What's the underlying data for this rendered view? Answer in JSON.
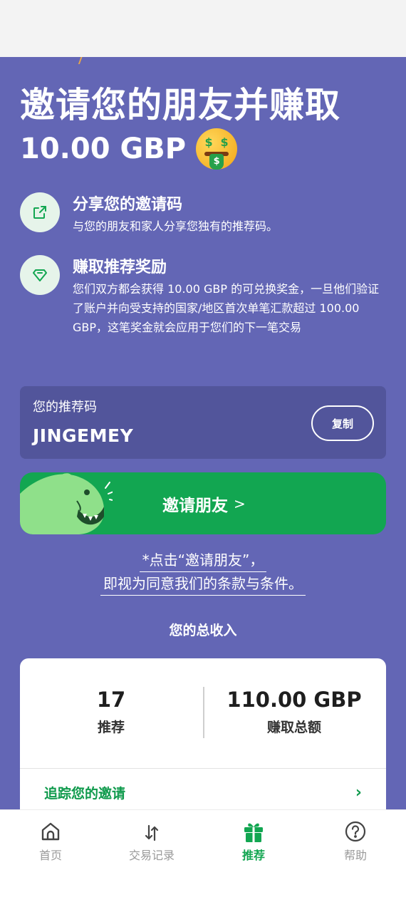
{
  "header": {
    "title": "邀请您的朋友并赚取",
    "amount": "10.00 GBP",
    "emoji_icon": "money-mouth-face-icon"
  },
  "features": [
    {
      "icon": "share-icon",
      "heading": "分享您的邀请码",
      "description": "与您的朋友和家人分享您独有的推荐码。"
    },
    {
      "icon": "diamond-icon",
      "heading": "赚取推荐奖励",
      "description": "您们双方都会获得 10.00 GBP 的可兑换奖金，一旦他们验证了账户并向受支持的国家/地区首次单笔汇款超过 100.00 GBP，这笔奖金就会应用于您们的下一笔交易"
    }
  ],
  "referral_code": {
    "label": "您的推荐码",
    "code": "JINGEMEY",
    "copy_label": "复制"
  },
  "invite_button": {
    "label": "邀请朋友",
    "arrow": ">"
  },
  "terms": {
    "line1": "*点击“邀请朋友”，",
    "line2": "即视为同意我们的条款与条件。"
  },
  "earnings": {
    "heading": "您的总收入",
    "referrals_value": "17",
    "referrals_label": "推荐",
    "earned_value": "110.00 GBP",
    "earned_label": "赚取总额",
    "track_label": "追踪您的邀请",
    "track_chevron": "›"
  },
  "nav": {
    "items": [
      {
        "label": "首页",
        "icon": "home-icon",
        "active": false
      },
      {
        "label": "交易记录",
        "icon": "transactions-icon",
        "active": false
      },
      {
        "label": "推荐",
        "icon": "gift-icon",
        "active": true
      },
      {
        "label": "帮助",
        "icon": "help-icon",
        "active": false
      }
    ]
  },
  "colors": {
    "background": "#6366b5",
    "card": "#52559b",
    "accent_green": "#12a651",
    "white": "#ffffff"
  }
}
